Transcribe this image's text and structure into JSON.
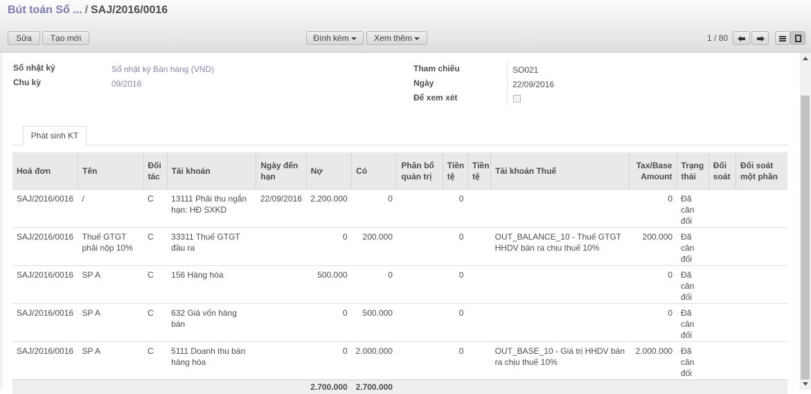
{
  "breadcrumb": {
    "parent": "Bút toán Sổ ...",
    "separator": "/",
    "current": "SAJ/2016/0016"
  },
  "toolbar": {
    "edit": "Sửa",
    "create": "Tạo mới",
    "attach": "Đính kèm",
    "more": "Xem thêm",
    "pager": "1 / 80"
  },
  "form": {
    "journal_label": "Sổ nhật ký",
    "journal_value": "Sổ nhật ký Bán hàng (VND)",
    "period_label": "Chu kỳ",
    "period_value": "09/2016",
    "ref_label": "Tham chiếu",
    "ref_value": "SO021",
    "date_label": "Ngày",
    "date_value": "22/09/2016",
    "review_label": "Để xem xét"
  },
  "tab": {
    "label": "Phát sinh KT"
  },
  "table": {
    "headers": [
      "Hoá đơn",
      "Tên",
      "Đối tác",
      "Tài khoản",
      "Ngày đến hạn",
      "Nợ",
      "Có",
      "Phân bổ quản trị",
      "Tiền tệ",
      "Tiền tệ",
      "Tài khoản Thuế",
      "Tax/Base Amount",
      "Trạng thái",
      "Đối soát",
      "Đối soát một phần"
    ],
    "rows": [
      [
        "SAJ/2016/0016",
        "/",
        "C",
        "13111 Phải thu ngắn hạn: HĐ SXKD",
        "22/09/2016",
        "2.200.000",
        "0",
        "",
        "0",
        "",
        "",
        "0",
        "Đã cân đối",
        "",
        ""
      ],
      [
        "SAJ/2016/0016",
        "Thuế GTGT phải nộp 10%",
        "C",
        "33311 Thuế GTGT đầu ra",
        "",
        "0",
        "200.000",
        "",
        "0",
        "",
        "OUT_BALANCE_10 - Thuế GTGT HHDV bán ra chịu thuế 10%",
        "200.000",
        "Đã cân đối",
        "",
        ""
      ],
      [
        "SAJ/2016/0016",
        "SP A",
        "C",
        "156 Hàng hóa",
        "",
        "500.000",
        "0",
        "",
        "0",
        "",
        "",
        "0",
        "Đã cân đối",
        "",
        ""
      ],
      [
        "SAJ/2016/0016",
        "SP A",
        "C",
        "632 Giá vốn hàng bán",
        "",
        "0",
        "500.000",
        "",
        "0",
        "",
        "",
        "0",
        "Đã cân đối",
        "",
        ""
      ],
      [
        "SAJ/2016/0016",
        "SP A",
        "C",
        "5111 Doanh thu bán hàng hóa",
        "",
        "0",
        "2.000.000",
        "",
        "0",
        "",
        "OUT_BASE_10 - Giá trị HHDV bán ra chịu thuế 10%",
        "2.000.000",
        "Đã cân đối",
        "",
        ""
      ]
    ],
    "totals": {
      "debit": "2.700.000",
      "credit": "2.700.000"
    }
  }
}
